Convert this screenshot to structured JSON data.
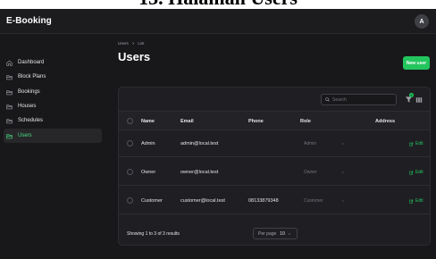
{
  "caption": "13. Halaman Users",
  "app": {
    "brand": "E-Booking",
    "avatar_initial": "A"
  },
  "sidebar": {
    "items": [
      {
        "label": "Dashboard",
        "icon": "home-icon",
        "active": false
      },
      {
        "label": "Block Plans",
        "icon": "folder-icon",
        "active": false
      },
      {
        "label": "Bookings",
        "icon": "folder-icon",
        "active": false
      },
      {
        "label": "Houses",
        "icon": "folder-icon",
        "active": false
      },
      {
        "label": "Schedules",
        "icon": "folder-icon",
        "active": false
      },
      {
        "label": "Users",
        "icon": "folder-icon",
        "active": true
      }
    ]
  },
  "header": {
    "breadcrumb": [
      "Users",
      ">",
      "List"
    ],
    "title": "Users",
    "new_button": "New user"
  },
  "table": {
    "search_placeholder": "Search",
    "filter_count": "0",
    "columns": [
      "Name",
      "Email",
      "Phone",
      "Role",
      "Address"
    ],
    "rows": [
      {
        "name": "Admin",
        "email": "admin@local.test",
        "phone": "",
        "role": "Admin",
        "address": "",
        "action": "Edit"
      },
      {
        "name": "Owner",
        "email": "owner@local.test",
        "phone": "",
        "role": "Owner",
        "address": "",
        "action": "Edit"
      },
      {
        "name": "Customer",
        "email": "customer@local.test",
        "phone": "08133879348",
        "role": "Customer",
        "address": "",
        "action": "Edit"
      }
    ],
    "showing_text": "Showing 1 to 3 of 3 results",
    "per_page_label": "Per page",
    "per_page_value": "10"
  },
  "colors": {
    "accent": "#22c55e",
    "background": "#18181b",
    "card": "#1f1f23",
    "active_nav": "#27272a"
  }
}
